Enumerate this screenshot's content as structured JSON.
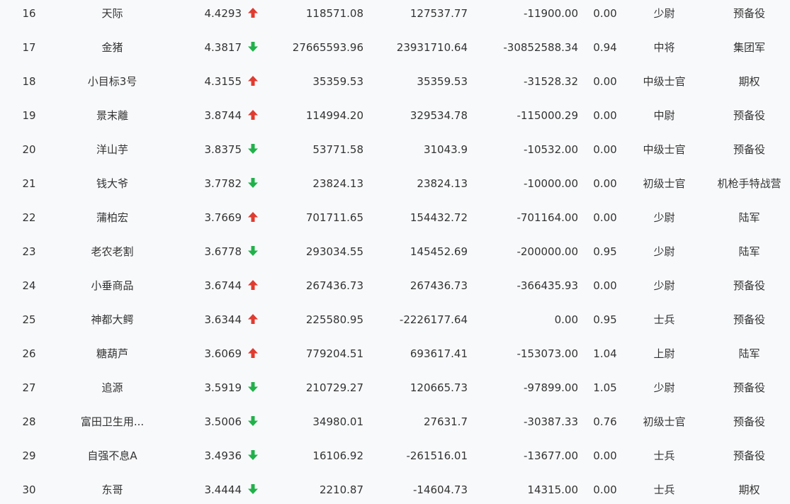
{
  "colors": {
    "up": "#e03b30",
    "down": "#21b14a",
    "text": "#333333",
    "background": "#f8f9fb"
  },
  "icons": {
    "up": "arrow-up-icon",
    "down": "arrow-down-icon"
  },
  "rows": [
    {
      "idx": "16",
      "name": "天际",
      "score": "4.4293",
      "trend": "up",
      "v1": "118571.08",
      "v2": "127537.77",
      "v3": "-11900.00",
      "ratio": "0.00",
      "rank": "少尉",
      "unit": "预备役"
    },
    {
      "idx": "17",
      "name": "金猪",
      "score": "4.3817",
      "trend": "down",
      "v1": "27665593.96",
      "v2": "23931710.64",
      "v3": "-30852588.34",
      "ratio": "0.94",
      "rank": "中将",
      "unit": "集团军"
    },
    {
      "idx": "18",
      "name": "小目标3号",
      "score": "4.3155",
      "trend": "up",
      "v1": "35359.53",
      "v2": "35359.53",
      "v3": "-31528.32",
      "ratio": "0.00",
      "rank": "中级士官",
      "unit": "期权"
    },
    {
      "idx": "19",
      "name": "景末離",
      "score": "3.8744",
      "trend": "up",
      "v1": "114994.20",
      "v2": "329534.78",
      "v3": "-115000.29",
      "ratio": "0.00",
      "rank": "中尉",
      "unit": "预备役"
    },
    {
      "idx": "20",
      "name": "洋山芋",
      "score": "3.8375",
      "trend": "down",
      "v1": "53771.58",
      "v2": "31043.9",
      "v3": "-10532.00",
      "ratio": "0.00",
      "rank": "中级士官",
      "unit": "预备役"
    },
    {
      "idx": "21",
      "name": "钱大爷",
      "score": "3.7782",
      "trend": "down",
      "v1": "23824.13",
      "v2": "23824.13",
      "v3": "-10000.00",
      "ratio": "0.00",
      "rank": "初级士官",
      "unit": "机枪手特战营"
    },
    {
      "idx": "22",
      "name": "蒲柏宏",
      "score": "3.7669",
      "trend": "up",
      "v1": "701711.65",
      "v2": "154432.72",
      "v3": "-701164.00",
      "ratio": "0.00",
      "rank": "少尉",
      "unit": "陆军"
    },
    {
      "idx": "23",
      "name": "老农老割",
      "score": "3.6778",
      "trend": "down",
      "v1": "293034.55",
      "v2": "145452.69",
      "v3": "-200000.00",
      "ratio": "0.95",
      "rank": "少尉",
      "unit": "陆军"
    },
    {
      "idx": "24",
      "name": "小垂商品",
      "score": "3.6744",
      "trend": "up",
      "v1": "267436.73",
      "v2": "267436.73",
      "v3": "-366435.93",
      "ratio": "0.00",
      "rank": "少尉",
      "unit": "预备役"
    },
    {
      "idx": "25",
      "name": "神都大鳄",
      "score": "3.6344",
      "trend": "up",
      "v1": "225580.95",
      "v2": "-2226177.64",
      "v3": "0.00",
      "ratio": "0.95",
      "rank": "士兵",
      "unit": "预备役"
    },
    {
      "idx": "26",
      "name": "糖葫芦",
      "score": "3.6069",
      "trend": "up",
      "v1": "779204.51",
      "v2": "693617.41",
      "v3": "-153073.00",
      "ratio": "1.04",
      "rank": "上尉",
      "unit": "陆军"
    },
    {
      "idx": "27",
      "name": "追源",
      "score": "3.5919",
      "trend": "down",
      "v1": "210729.27",
      "v2": "120665.73",
      "v3": "-97899.00",
      "ratio": "1.05",
      "rank": "少尉",
      "unit": "预备役"
    },
    {
      "idx": "28",
      "name": "富田卫生用...",
      "score": "3.5006",
      "trend": "down",
      "v1": "34980.01",
      "v2": "27631.7",
      "v3": "-30387.33",
      "ratio": "0.76",
      "rank": "初级士官",
      "unit": "预备役"
    },
    {
      "idx": "29",
      "name": "自强不息A",
      "score": "3.4936",
      "trend": "down",
      "v1": "16106.92",
      "v2": "-261516.01",
      "v3": "-13677.00",
      "ratio": "0.00",
      "rank": "士兵",
      "unit": "预备役"
    },
    {
      "idx": "30",
      "name": "东哥",
      "score": "3.4444",
      "trend": "down",
      "v1": "2210.87",
      "v2": "-14604.73",
      "v3": "14315.00",
      "ratio": "0.00",
      "rank": "士兵",
      "unit": "期权"
    }
  ]
}
